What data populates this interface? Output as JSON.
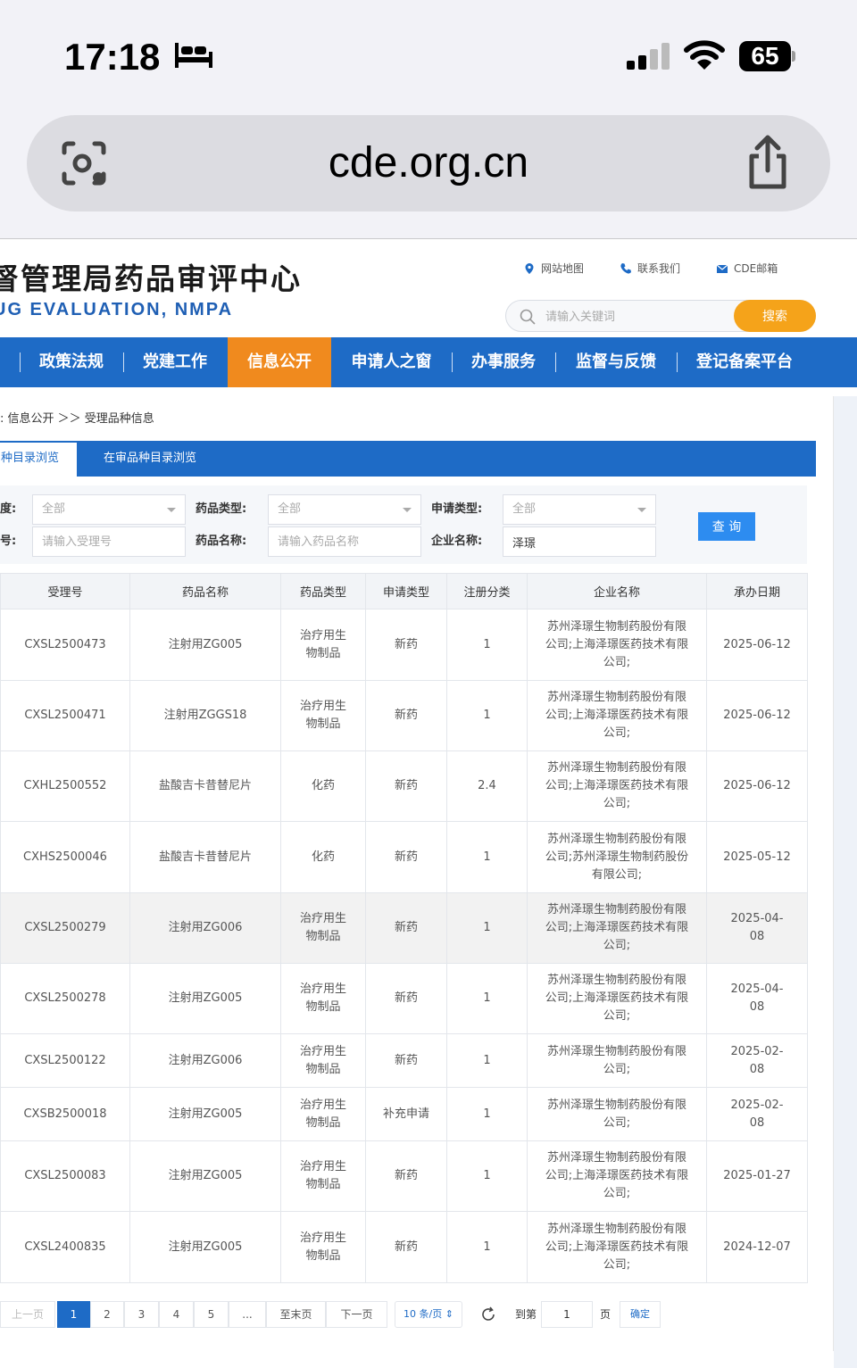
{
  "status_bar": {
    "time": "17:18",
    "battery": "65"
  },
  "url_bar": {
    "url": "cde.org.cn"
  },
  "header": {
    "title": "督管理局药品审评中心",
    "subtitle": "UG EVALUATION, NMPA",
    "links": [
      "网站地图",
      "联系我们",
      "CDE邮箱"
    ],
    "search_placeholder": "请输入关键词",
    "search_button": "搜索"
  },
  "nav": {
    "first_fragment": "",
    "items": [
      "政策法规",
      "党建工作",
      "信息公开",
      "申请人之窗",
      "办事服务",
      "监督与反馈",
      "登记备案平台"
    ],
    "active": "信息公开"
  },
  "breadcrumb": ": 信息公开 ＞＞ 受理品种信息",
  "tabs": {
    "active": "种目录浏览",
    "other": "在审品种目录浏览"
  },
  "filters": {
    "row1": [
      {
        "label": "度:",
        "value": "全部"
      },
      {
        "label": "药品类型:",
        "value": "全部"
      },
      {
        "label": "申请类型:",
        "value": "全部"
      }
    ],
    "row2": [
      {
        "label": "号:",
        "placeholder": "请输入受理号",
        "value": ""
      },
      {
        "label": "药品名称:",
        "placeholder": "请输入药品名称",
        "value": ""
      },
      {
        "label": "企业名称:",
        "placeholder": "",
        "value": "泽璟"
      }
    ],
    "query_button": "查 询"
  },
  "table": {
    "headers": [
      "受理号",
      "药品名称",
      "药品类型",
      "申请类型",
      "注册分类",
      "企业名称",
      "承办日期"
    ],
    "rows": [
      [
        "CXSL2500473",
        "注射用ZG005",
        "治疗用生物制品",
        "新药",
        "1",
        "苏州泽璟生物制药股份有限公司;上海泽璟医药技术有限公司;",
        "2025-06-12"
      ],
      [
        "CXSL2500471",
        "注射用ZGGS18",
        "治疗用生物制品",
        "新药",
        "1",
        "苏州泽璟生物制药股份有限公司;上海泽璟医药技术有限公司;",
        "2025-06-12"
      ],
      [
        "CXHL2500552",
        "盐酸吉卡昔替尼片",
        "化药",
        "新药",
        "2.4",
        "苏州泽璟生物制药股份有限公司;上海泽璟医药技术有限公司;",
        "2025-06-12"
      ],
      [
        "CXHS2500046",
        "盐酸吉卡昔替尼片",
        "化药",
        "新药",
        "1",
        "苏州泽璟生物制药股份有限公司;苏州泽璟生物制药股份有限公司;",
        "2025-05-12"
      ],
      [
        "CXSL2500279",
        "注射用ZG006",
        "治疗用生物制品",
        "新药",
        "1",
        "苏州泽璟生物制药股份有限公司;上海泽璟医药技术有限公司;",
        "2025-04-08"
      ],
      [
        "CXSL2500278",
        "注射用ZG005",
        "治疗用生物制品",
        "新药",
        "1",
        "苏州泽璟生物制药股份有限公司;上海泽璟医药技术有限公司;",
        "2025-04-08"
      ],
      [
        "CXSL2500122",
        "注射用ZG006",
        "治疗用生物制品",
        "新药",
        "1",
        "苏州泽璟生物制药股份有限公司;",
        "2025-02-08"
      ],
      [
        "CXSB2500018",
        "注射用ZG005",
        "治疗用生物制品",
        "补充申请",
        "1",
        "苏州泽璟生物制药股份有限公司;",
        "2025-02-08"
      ],
      [
        "CXSL2500083",
        "注射用ZG005",
        "治疗用生物制品",
        "新药",
        "1",
        "苏州泽璟生物制药股份有限公司;上海泽璟医药技术有限公司;",
        "2025-01-27"
      ],
      [
        "CXSL2400835",
        "注射用ZG005",
        "治疗用生物制品",
        "新药",
        "1",
        "苏州泽璟生物制药股份有限公司;上海泽璟医药技术有限公司;",
        "2024-12-07"
      ]
    ]
  },
  "pager": {
    "prev": "上一页",
    "pages": [
      "1",
      "2",
      "3",
      "4",
      "5"
    ],
    "ellipsis": "...",
    "last": "至末页",
    "next": "下一页",
    "per_page": "10 条/页",
    "goto_label": "到第",
    "goto_value": "1",
    "page_unit": "页",
    "confirm": "确定"
  },
  "colors": {
    "nav_blue": "#1e6bc6",
    "nav_active": "#f08a1e",
    "search_orange": "#f5a31a",
    "query_blue": "#2d8cf0"
  }
}
